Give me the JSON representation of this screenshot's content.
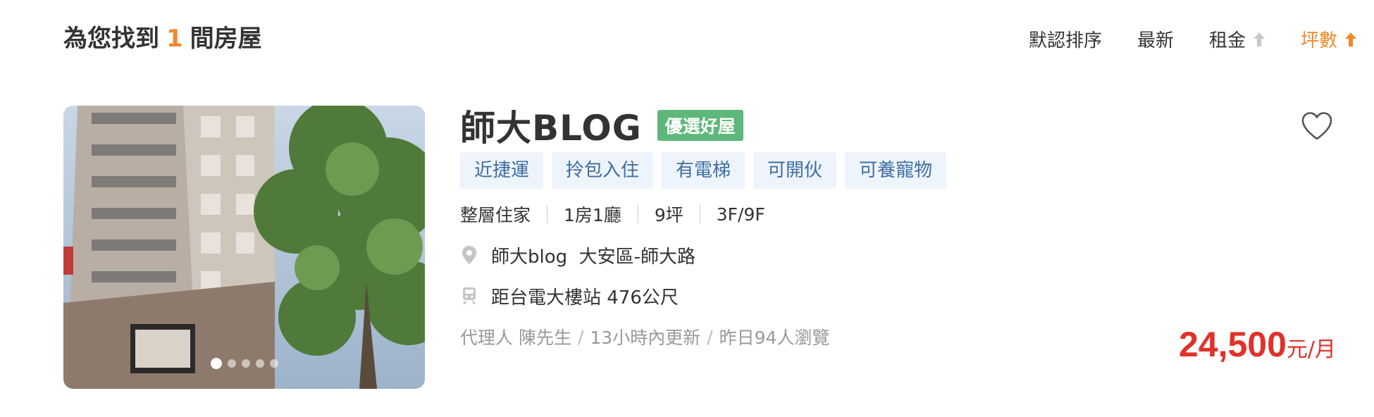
{
  "header": {
    "result_prefix": "為您找到",
    "result_count": "1",
    "result_suffix": "間房屋",
    "sort_options": [
      {
        "label": "默認排序",
        "arrow": null,
        "active": false
      },
      {
        "label": "最新",
        "arrow": null,
        "active": false
      },
      {
        "label": "租金",
        "arrow": "arrow-up-icon",
        "active": false
      },
      {
        "label": "坪數",
        "arrow": "arrow-up-icon",
        "active": true
      }
    ]
  },
  "listing": {
    "title": "師大BLOG",
    "badge": "優選好屋",
    "tags": [
      "近捷運",
      "拎包入住",
      "有電梯",
      "可開伙",
      "可養寵物"
    ],
    "specs": [
      "整層住家",
      "1房1廳",
      "9坪",
      "3F/9F"
    ],
    "location": "師大blog  大安區-師大路",
    "transit": "距台電大樓站 476公尺",
    "meta": [
      "代理人 陳先生",
      "13小時內更新",
      "昨日94人瀏覽"
    ],
    "price": "24,500",
    "price_unit": "元/月",
    "photo_count": 5,
    "photo_index": 1
  },
  "icons": {
    "location": "location-pin-icon",
    "transit": "train-icon",
    "favorite": "heart-outline-icon"
  },
  "colors": {
    "accent": "#ef8a2c",
    "badge": "#5db879",
    "tag_text": "#3f6ea3",
    "tag_bg": "#eef4fb",
    "price": "#e0322b",
    "meta": "#999999"
  }
}
